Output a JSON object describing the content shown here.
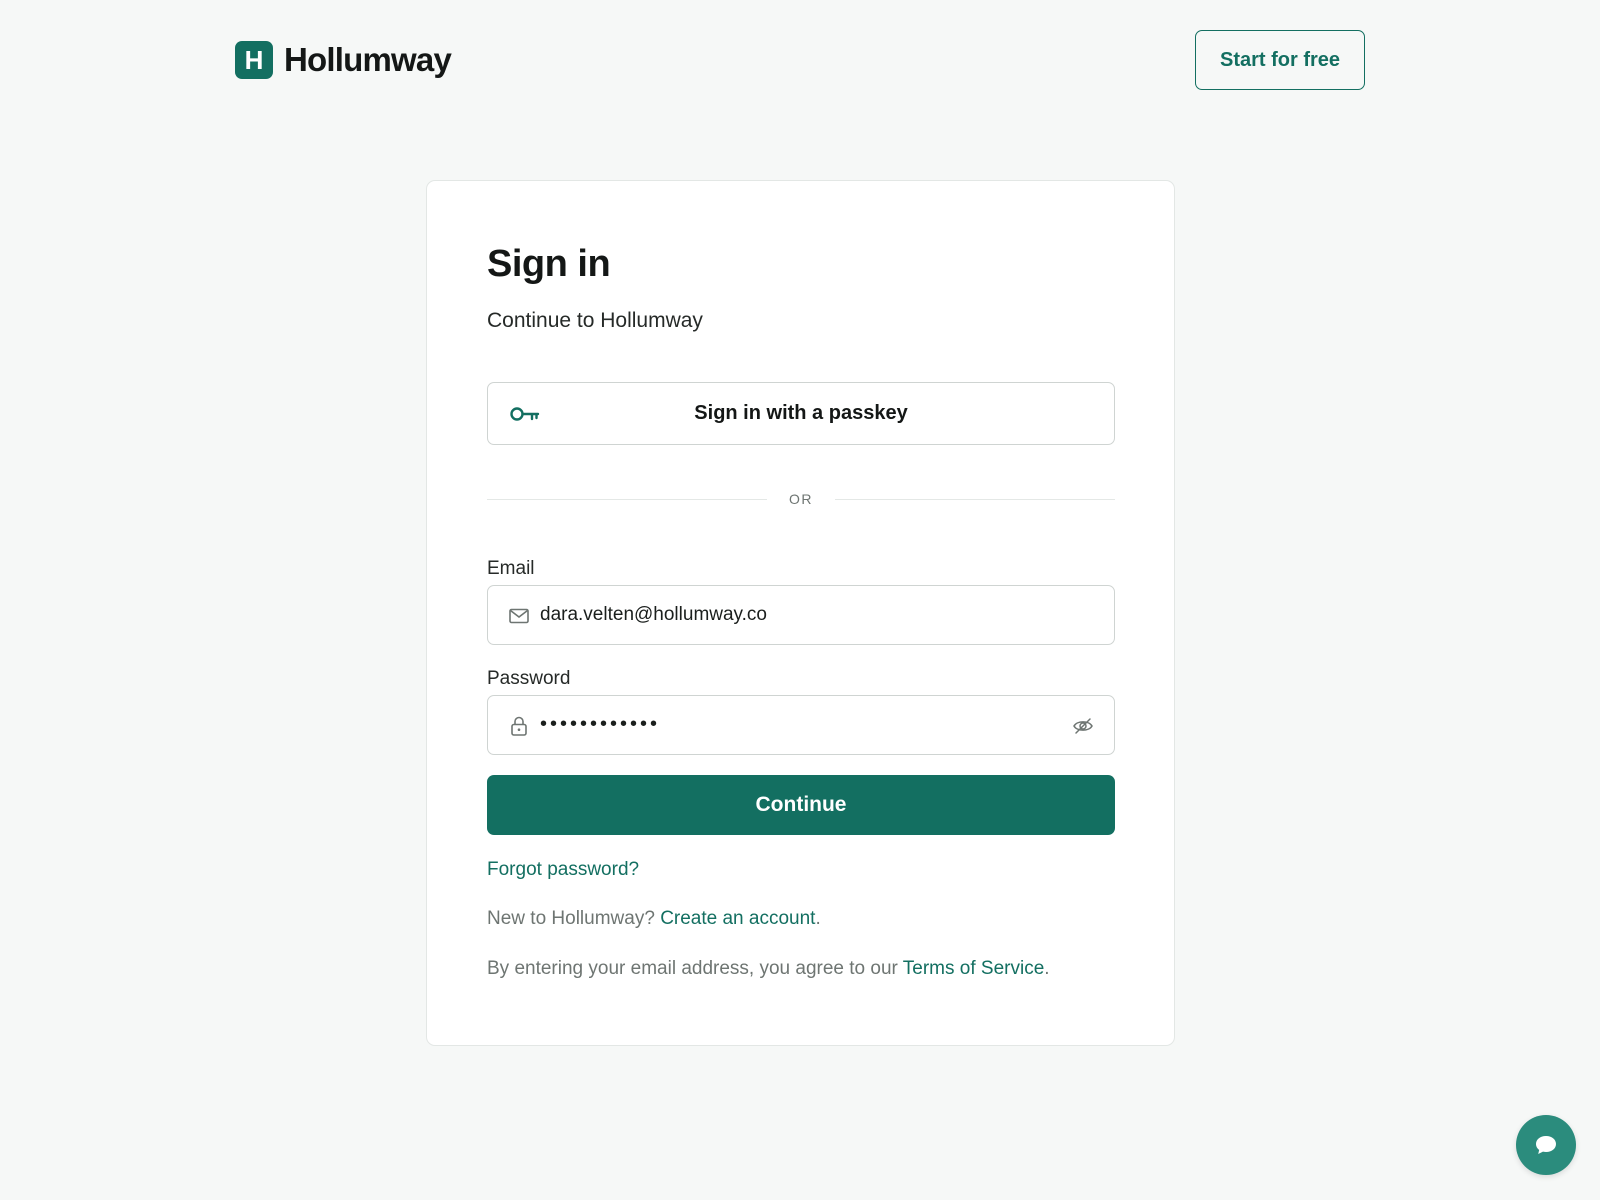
{
  "brand": {
    "logo_letter": "H",
    "name": "Hollumway",
    "accent_color": "#136f61"
  },
  "header": {
    "start_button": "Start for free"
  },
  "signin": {
    "title": "Sign in",
    "subtitle": "Continue to Hollumway",
    "passkey_button": "Sign in with a passkey",
    "passkey_icon": "key-icon",
    "divider": "OR",
    "email": {
      "label": "Email",
      "value": "dara.velten@hollumway.co",
      "icon": "mail-icon"
    },
    "password": {
      "label": "Password",
      "value": "••••••••••••",
      "icon": "lock-icon",
      "toggle_icon": "eye-slash-icon"
    },
    "continue_button": "Continue",
    "forgot_link": "Forgot password?",
    "new_prefix": "New to Hollumway?",
    "create_link": "Create an account",
    "create_suffix": ".",
    "terms_prefix": "By entering your email address, you agree to our",
    "terms_link": "Terms of Service",
    "terms_suffix": "."
  },
  "chat": {
    "icon": "chat-bubble-icon"
  }
}
